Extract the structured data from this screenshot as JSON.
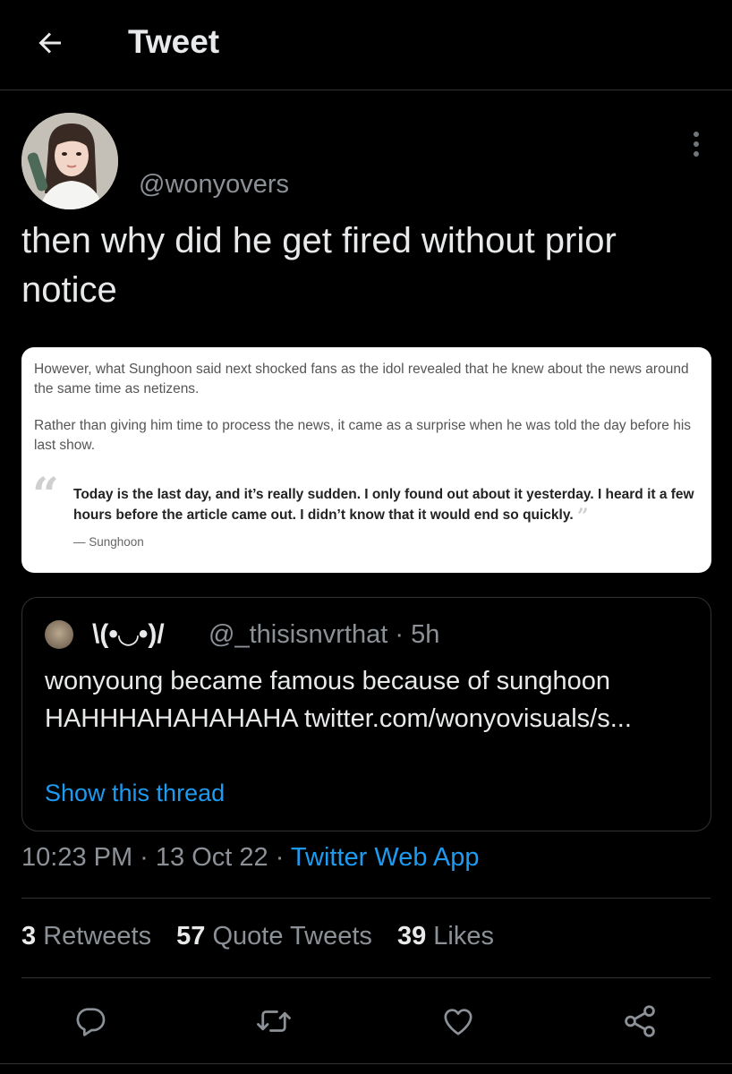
{
  "header": {
    "title": "Tweet",
    "back_icon": "arrow-left-icon"
  },
  "tweet": {
    "handle": "@wonyovers",
    "text": "then why did he get fired without prior notice",
    "more_icon": "more-vertical-icon",
    "media": {
      "paragraph1": "However, what Sunghoon said next shocked fans as the idol revealed that he knew about the news around the same time as netizens.",
      "paragraph2": "Rather than giving him time to process the news, it came as a surprise when he was told the day before his last show.",
      "quote": "Today is the last day, and it’s really sudden. I only found out about it yesterday. I heard it a few hours before the article came out. I didn’t know that it would end so quickly.",
      "quote_author": "— Sunghoon",
      "open_quote": "“",
      "close_quote": "”"
    },
    "quoted": {
      "name": "\\(•◡•)/",
      "handle_time": "@_thisisnvrthat · 5h",
      "text": "wonyoung became famous because of sunghoon HAHHHAHAHAHAHA twitter.com/wonyovisuals/s...",
      "show_thread": "Show this thread"
    },
    "timestamp": "10:23 PM · 13 Oct 22 · ",
    "source_app": "Twitter Web App",
    "stats": {
      "retweets_count": "3",
      "retweets_label": "Retweets",
      "quotes_count": "57",
      "quotes_label": "Quote Tweets",
      "likes_count": "39",
      "likes_label": "Likes"
    },
    "actions": [
      "reply-icon",
      "retweet-icon",
      "like-icon",
      "share-icon"
    ]
  },
  "colors": {
    "background": "#000000",
    "text": "#e7e9ea",
    "muted": "#8b9196",
    "link": "#1d9bf0",
    "border": "#2f3336"
  }
}
